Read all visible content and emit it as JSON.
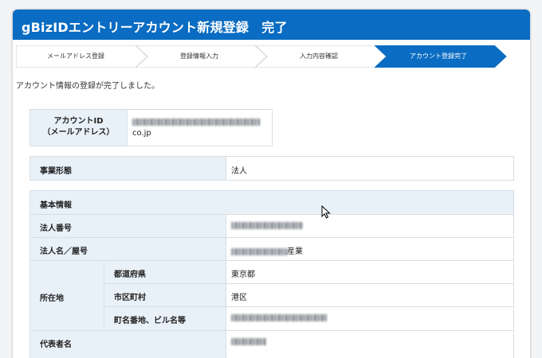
{
  "header": {
    "title": "gBizIDエントリーアカウント新規登録　完了"
  },
  "steps": [
    {
      "label": "メールアドレス登録",
      "active": false
    },
    {
      "label": "登録情報入力",
      "active": false
    },
    {
      "label": "入力内容確認",
      "active": false
    },
    {
      "label": "アカウント登録完了",
      "active": true
    }
  ],
  "message": "アカウント情報の登録が完了しました。",
  "account": {
    "label_line1": "アカウントID",
    "label_line2": "（メールアドレス）",
    "value_suffix": "co.jp"
  },
  "business_type": {
    "label": "事業形態",
    "value": "法人"
  },
  "basic_info": {
    "section_title": "基本情報",
    "corp_number_label": "法人番号",
    "corp_name_label": "法人名／屋号",
    "corp_name_suffix": "産業",
    "address_label": "所在地",
    "prefecture_label": "都道府県",
    "prefecture_value": "東京都",
    "city_label": "市区町村",
    "city_value": "港区",
    "street_label": "町名番地、ビル名等",
    "representative_label": "代表者名"
  },
  "colors": {
    "header": "#0a6cc2",
    "label_bg": "#e8f1f8",
    "active_step": "#0a6cc2"
  }
}
